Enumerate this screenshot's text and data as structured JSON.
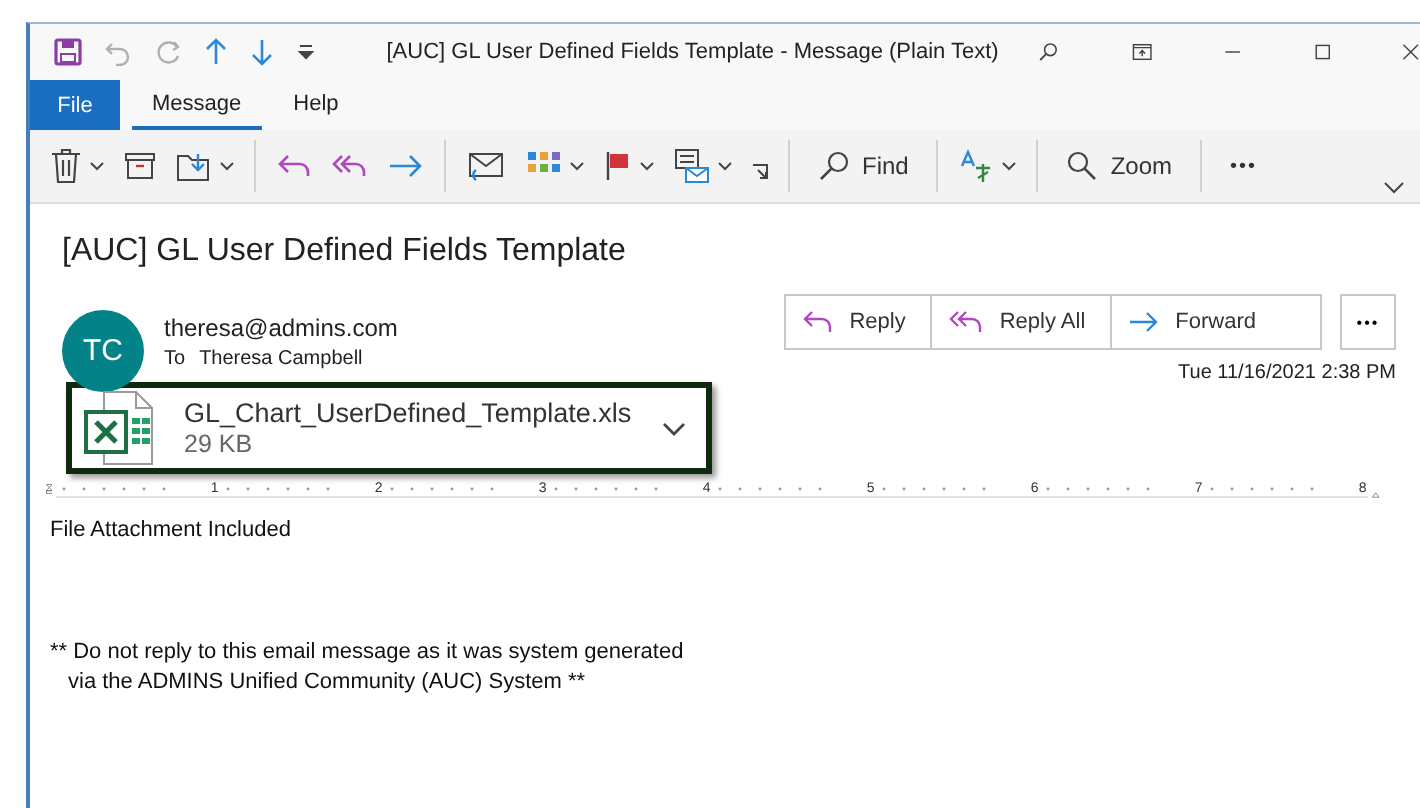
{
  "window": {
    "title": "[AUC] GL User Defined Fields Template  -  Message (Plain Text)"
  },
  "tabs": [
    {
      "label": "File",
      "kind": "backstage",
      "selected": false
    },
    {
      "label": "Message",
      "kind": "tab",
      "selected": true
    },
    {
      "label": "Help",
      "kind": "tab",
      "selected": false
    }
  ],
  "toolbar": {
    "find_label": "Find",
    "zoom_label": "Zoom",
    "more": "•••"
  },
  "message": {
    "subject": "[AUC] GL User Defined Fields Template",
    "avatar_initials": "TC",
    "sender": "theresa@admins.com",
    "to_label": "To",
    "recipient": "Theresa Campbell",
    "actions": [
      {
        "label": "Reply",
        "kind": "reply"
      },
      {
        "label": "Reply All",
        "kind": "reply_all"
      },
      {
        "label": "Forward",
        "kind": "forward"
      }
    ],
    "more": "•••",
    "date": "Tue 11/16/2021 2:38 PM",
    "attachment": {
      "name": "GL_Chart_UserDefined_Template.xls",
      "size": "29 KB"
    }
  },
  "ruler": [
    "1",
    "2",
    "3",
    "4",
    "5",
    "6",
    "7",
    "8"
  ],
  "body": [
    {
      "lines": [
        "File Attachment Included"
      ]
    },
    {
      "lines": [
        "** Do not reply to this email message as it was system generated",
        "via the ADMINS Unified Community (AUC) System **"
      ]
    }
  ]
}
